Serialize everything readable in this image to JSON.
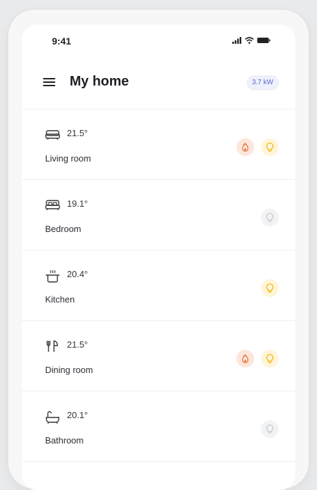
{
  "status_bar": {
    "time": "9:41"
  },
  "header": {
    "title": "My home",
    "power_badge": "3.7 kW"
  },
  "rooms": [
    {
      "name": "Living room",
      "temperature": "21.5°",
      "icon": "sofa-icon",
      "heating_on": true,
      "light_on": true
    },
    {
      "name": "Bedroom",
      "temperature": "19.1°",
      "icon": "bed-icon",
      "heating_on": false,
      "light_on": false
    },
    {
      "name": "Kitchen",
      "temperature": "20.4°",
      "icon": "cooking-pot-icon",
      "heating_on": false,
      "light_on": true
    },
    {
      "name": "Dining room",
      "temperature": "21.5°",
      "icon": "fork-knife-icon",
      "heating_on": true,
      "light_on": true
    },
    {
      "name": "Bathroom",
      "temperature": "20.1°",
      "icon": "bathtub-icon",
      "heating_on": false,
      "light_on": false
    }
  ],
  "colors": {
    "heat": "#e8763d",
    "light_on": "#f2b51f",
    "light_off": "#c9cbd0",
    "badge": "#5a68c9"
  }
}
